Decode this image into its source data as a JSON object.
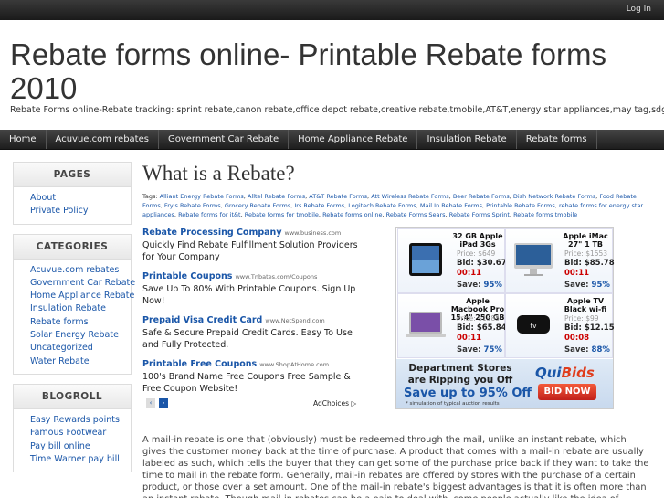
{
  "topbar": {
    "login": "Log In"
  },
  "site": {
    "title": "Rebate forms online- Printable Rebate forms 2010",
    "tagline": "Rebate Forms online-Rebate tracking: sprint rebate,canon rebate,office depot rebate,creative rebate,tmobile,AT&T,energy star appliances,may tag,sdg&e"
  },
  "nav": [
    "Home",
    "Acuvue.com rebates",
    "Government Car Rebate",
    "Home Appliance Rebate",
    "Insulation Rebate",
    "Rebate forms"
  ],
  "sidebar": {
    "pages": {
      "title": "PAGES",
      "items": [
        "About",
        "Private Policy"
      ]
    },
    "categories": {
      "title": "CATEGORIES",
      "items": [
        "Acuvue.com rebates",
        "Government Car Rebate",
        "Home Appliance Rebate",
        "Insulation Rebate",
        "Rebate forms",
        "Solar Energy Rebate",
        "Uncategorized",
        "Water Rebate"
      ]
    },
    "blogroll": {
      "title": "BLOGROLL",
      "items": [
        "Easy Rewards points",
        "Famous Footwear",
        "Pay bill online",
        "Time Warner pay bill"
      ]
    }
  },
  "post": {
    "title": "What is a Rebate?",
    "tags_label": "Tags:",
    "tags": [
      "Alliant Energy Rebate Forms",
      "Alltel Rebate Forms",
      "AT&T Rebate Forms",
      "Att Wireless Rebate Forms",
      "Beer Rebate Forms",
      "Dish Network Rebate Forms",
      "Food Rebate Forms",
      "Fry's Rebate Forms",
      "Grocery Rebate Forms",
      "Irs Rebate Forms",
      "Logitech Rebate Forms",
      "Mail In Rebate Forms",
      "Printable Rebate Forms",
      "rebate forms for energy star appliances",
      "Rebate forms for it&t",
      "Rebate forms for tmobile",
      "Rebate forms online",
      "Rebate Forms Sears",
      "Rebate Forms Sprint",
      "Rebate forms tmobile"
    ],
    "body": "A mail-in rebate is one that (obviously) must be redeemed through the mail, unlike an instant rebate, which gives the customer money back at the time of purchase. A product that comes with a mail-in rebate are usually labeled as such, which tells the buyer that they can get some of the purchase price back if they want to take the time to mail in the rebate form. Generally, mail-in rebates are offered by stores with the purchase of a certain product, or those over a set amount. One of the mail-in rebate's biggest advantages is that it is often more than an instant rebate. Though mail-in rebates can be a pain to deal with, some people actually like the idea of getting a check in the mail weeks or months after making that"
  },
  "ads": [
    {
      "title": "Rebate Processing Company",
      "url": "www.business.com",
      "desc": "Quickly Find Rebate Fulfillment Solution Providers for Your Company"
    },
    {
      "title": "Printable Coupons",
      "url": "www.Tnbates.com/Coupons",
      "desc": "Save Up To 80% With Printable Coupons. Sign Up Now!"
    },
    {
      "title": "Prepaid Visa Credit Card",
      "url": "www.NetSpend.com",
      "desc": "Safe & Secure Prepaid Credit Cards. Easy To Use and Fully Protected."
    },
    {
      "title": "Printable Free Coupons",
      "url": "www.ShopAtHome.com",
      "desc": "100's Brand Name Free Coupons Free Sample & Free Coupon Website!"
    }
  ],
  "adnav": {
    "prev": "‹",
    "next": "›",
    "adchoices": "AdChoices ▷"
  },
  "banner": {
    "products": [
      {
        "name": "32 GB Apple iPad 3Gs",
        "price": "Price: $649",
        "bid": "Bid: $30.67",
        "timer": "00:11",
        "save_label": "Save: ",
        "save_pct": "95%"
      },
      {
        "name": "Apple iMac 27\" 1 TB",
        "price": "Price: $1553",
        "bid": "Bid: $85.78",
        "timer": "00:11",
        "save_label": "Save: ",
        "save_pct": "95%"
      },
      {
        "name": "Apple Macbook Pro 15.4\" 250 GB",
        "price": "Price: $1385",
        "bid": "Bid: $65.84",
        "timer": "00:11",
        "save_label": "Save: ",
        "save_pct": "75%"
      },
      {
        "name": "Apple TV Black wi-fi",
        "price": "Price: $99",
        "bid": "Bid: $12.15",
        "timer": "00:08",
        "save_label": "Save: ",
        "save_pct": "88%"
      }
    ],
    "promo_line1": "Department Stores are Ripping you Off",
    "promo_line2": "Save up to 95% Off",
    "promo_note": "* simulation of typical auction results",
    "brand_a": "Qui",
    "brand_b": "Bids",
    "cta": "BID NOW"
  }
}
